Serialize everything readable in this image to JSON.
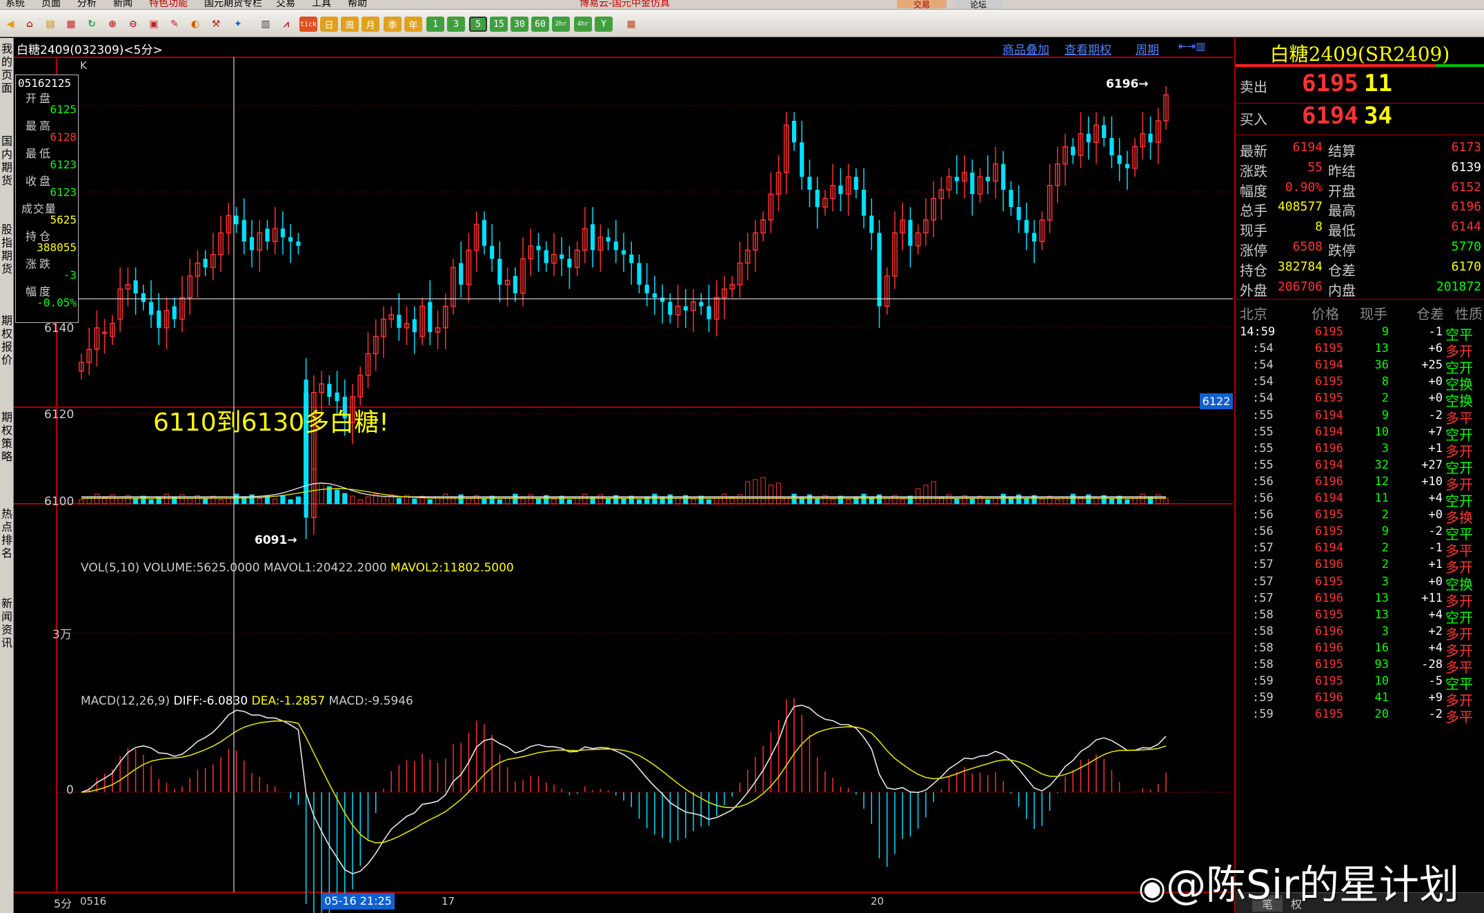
{
  "menubar": {
    "items": [
      "系统",
      "页面",
      "分析",
      "新闻",
      "特色功能",
      "国元期货专栏",
      "交易",
      "工具",
      "帮助"
    ],
    "title": "博易云-国元中金仿真",
    "trade_btn": "交易",
    "forum_btn": "论坛"
  },
  "toolbar": {
    "periods": [
      "tick",
      "日",
      "周",
      "月",
      "季",
      "年",
      "1",
      "3",
      "5",
      "15",
      "30",
      "60",
      "2hr",
      "4hr",
      "Y"
    ],
    "active_period": "5"
  },
  "sidenav": [
    "我的页面",
    "国内期货",
    "股指期货",
    "期权报价",
    "期权策略",
    "热点排名",
    "新闻资讯"
  ],
  "chart": {
    "header_title": "白糖2409(032309)<5分>",
    "links": [
      "商品叠加",
      "查看期权",
      "周期"
    ],
    "k_label": "K",
    "cursor_value": "6122",
    "annotation": "6110到6130多白糖!",
    "max_label": "6196",
    "min_label": "6091",
    "price_ticks": [
      "6140",
      "6120",
      "6100"
    ],
    "vol_tick": "3万",
    "macd_tick": "0",
    "vol_legend": {
      "prefix": "VOL(5,10) VOLUME:5625.0000 MAVOL1:20422.2000",
      "mavol2": "MAVOL2:11802.5000"
    },
    "macd_legend": {
      "name": "MACD(12,26,9)",
      "diff": "DIFF:-6.0830",
      "dea": "DEA:-1.2857",
      "macd": "MACD:-9.5946"
    },
    "xaxis": {
      "period": "5分",
      "labels": [
        "0516",
        "17",
        "20"
      ],
      "cursor_time": "05-16 21:25"
    },
    "info": {
      "time": "05162125",
      "rows": [
        {
          "label": "开盘",
          "value": "6125",
          "color": "#00ff00"
        },
        {
          "label": "最高",
          "value": "6128",
          "color": "#ff3232"
        },
        {
          "label": "最低",
          "value": "6123",
          "color": "#00ff00"
        },
        {
          "label": "收盘",
          "value": "6123",
          "color": "#00ff00"
        },
        {
          "label": "成交量",
          "value": "5625",
          "color": "#ffff00"
        },
        {
          "label": "持仓",
          "value": "388055",
          "color": "#ffff00"
        },
        {
          "label": "涨跌",
          "value": "-3",
          "color": "#00ff00"
        },
        {
          "label": "幅度",
          "value": "-0.05%",
          "color": "#00ff00"
        }
      ]
    }
  },
  "chart_data": {
    "type": "candlestick",
    "symbol": "白糖2409",
    "period": "5分",
    "ylim": [
      6085,
      6200
    ],
    "close": [
      6132,
      6135,
      6140,
      6139,
      6141,
      6149,
      6150,
      6148,
      6146,
      6143,
      6140,
      6144,
      6142,
      6147,
      6152,
      6155,
      6154,
      6157,
      6162,
      6166,
      6164,
      6160,
      6158,
      6162,
      6160,
      6163,
      6161,
      6160,
      6159,
      6096,
      6125,
      6127,
      6124,
      6123,
      6119,
      6124,
      6129,
      6134,
      6138,
      6142,
      6143,
      6140,
      6141,
      6139,
      6145,
      6139,
      6140,
      6145,
      6154,
      6150,
      6158,
      6164,
      6159,
      6156,
      6150,
      6151,
      6148,
      6156,
      6159,
      6158,
      6155,
      6157,
      6156,
      6154,
      6158,
      6163,
      6158,
      6161,
      6160,
      6158,
      6157,
      6155,
      6150,
      6148,
      6147,
      6146,
      6143,
      6145,
      6144,
      6146,
      6145,
      6142,
      6147,
      6149,
      6150,
      6155,
      6158,
      6162,
      6165,
      6171,
      6176,
      6187,
      6183,
      6175,
      6172,
      6168,
      6170,
      6173,
      6171,
      6175,
      6172,
      6166,
      6162,
      6145,
      6152,
      6162,
      6165,
      6159,
      6162,
      6165,
      6170,
      6172,
      6175,
      6174,
      6176,
      6171,
      6175,
      6174,
      6178,
      6172,
      6168,
      6165,
      6162,
      6160,
      6165,
      6173,
      6178,
      6182,
      6180,
      6185,
      6183,
      6187,
      6184,
      6180,
      6178,
      6177,
      6182,
      6185,
      6183,
      6188,
      6194
    ],
    "open": [
      6130,
      6132,
      6135,
      6139,
      6138,
      6142,
      6149,
      6151,
      6148,
      6146,
      6144,
      6140,
      6145,
      6142,
      6147,
      6152,
      6156,
      6154,
      6157,
      6162,
      6166,
      6165,
      6161,
      6158,
      6163,
      6160,
      6163,
      6161,
      6160,
      6128,
      6096,
      6125,
      6127,
      6125,
      6124,
      6118,
      6124,
      6129,
      6134,
      6138,
      6142,
      6143,
      6140,
      6142,
      6138,
      6146,
      6139,
      6140,
      6145,
      6155,
      6150,
      6158,
      6165,
      6159,
      6156,
      6150,
      6152,
      6148,
      6156,
      6159,
      6158,
      6155,
      6157,
      6156,
      6154,
      6158,
      6164,
      6158,
      6161,
      6160,
      6158,
      6157,
      6155,
      6150,
      6148,
      6147,
      6146,
      6143,
      6145,
      6144,
      6146,
      6145,
      6142,
      6147,
      6149,
      6150,
      6155,
      6158,
      6162,
      6165,
      6171,
      6176,
      6188,
      6183,
      6175,
      6172,
      6168,
      6170,
      6173,
      6171,
      6175,
      6172,
      6166,
      6162,
      6145,
      6152,
      6162,
      6165,
      6159,
      6162,
      6165,
      6170,
      6172,
      6175,
      6174,
      6176,
      6171,
      6175,
      6174,
      6178,
      6172,
      6168,
      6165,
      6162,
      6160,
      6165,
      6173,
      6178,
      6182,
      6180,
      6185,
      6183,
      6187,
      6184,
      6180,
      6178,
      6177,
      6182,
      6185,
      6183,
      6188
    ],
    "macd_range": [
      -9.8,
      8
    ]
  },
  "right_panel": {
    "title": "白糖2409(SR2409)",
    "ask": {
      "label": "卖出",
      "price": "6195",
      "qty": "11"
    },
    "bid": {
      "label": "买入",
      "price": "6194",
      "qty": "34"
    },
    "stats": [
      {
        "l": "最新",
        "v": "6194",
        "vc": "#ff3232",
        "l2": "结算",
        "v2": "6173",
        "v2c": "#ff3232"
      },
      {
        "l": "涨跌",
        "v": "55",
        "vc": "#ff3232",
        "l2": "昨结",
        "v2": "6139",
        "v2c": "#ffffff"
      },
      {
        "l": "幅度",
        "v": "0.90%",
        "vc": "#ff3232",
        "l2": "开盘",
        "v2": "6152",
        "v2c": "#ff3232"
      },
      {
        "l": "总手",
        "v": "408577",
        "vc": "#ffff00",
        "l2": "最高",
        "v2": "6196",
        "v2c": "#ff3232"
      },
      {
        "l": "现手",
        "v": "8",
        "vc": "#ffff00",
        "l2": "最低",
        "v2": "6144",
        "v2c": "#ff3232"
      },
      {
        "l": "涨停",
        "v": "6508",
        "vc": "#ff3232",
        "l2": "跌停",
        "v2": "5770",
        "v2c": "#00ff00"
      },
      {
        "l": "持仓",
        "v": "382784",
        "vc": "#ffff00",
        "l2": "仓差",
        "v2": "6170",
        "v2c": "#ffff00"
      },
      {
        "l": "外盘",
        "v": "206706",
        "vc": "#ff3232",
        "l2": "内盘",
        "v2": "201872",
        "v2c": "#00ff00"
      }
    ],
    "tick_header": [
      "北京",
      "价格",
      "现手",
      "仓差",
      "性质"
    ],
    "ticks": [
      [
        "14:59",
        "6195",
        "9",
        "-1",
        "空平",
        "#ff3232",
        "#00ff00"
      ],
      [
        ":54",
        "6195",
        "13",
        "+6",
        "多开",
        "#ff3232",
        "#ff3232"
      ],
      [
        ":54",
        "6194",
        "36",
        "+25",
        "空开",
        "#ff3232",
        "#00ff00"
      ],
      [
        ":54",
        "6195",
        "8",
        "+0",
        "空换",
        "#ff3232",
        "#00ff00"
      ],
      [
        ":54",
        "6195",
        "2",
        "+0",
        "空换",
        "#ff3232",
        "#00ff00"
      ],
      [
        ":55",
        "6194",
        "9",
        "-2",
        "多平",
        "#ff3232",
        "#ff3232"
      ],
      [
        ":55",
        "6194",
        "10",
        "+7",
        "空开",
        "#ff3232",
        "#00ff00"
      ],
      [
        ":55",
        "6196",
        "3",
        "+1",
        "多开",
        "#ff3232",
        "#ff3232"
      ],
      [
        ":55",
        "6194",
        "32",
        "+27",
        "空开",
        "#ff3232",
        "#00ff00"
      ],
      [
        ":56",
        "6196",
        "12",
        "+10",
        "多开",
        "#ff3232",
        "#ff3232"
      ],
      [
        ":56",
        "6194",
        "11",
        "+4",
        "空开",
        "#ff3232",
        "#00ff00"
      ],
      [
        ":56",
        "6195",
        "2",
        "+0",
        "多换",
        "#ff3232",
        "#ff3232"
      ],
      [
        ":56",
        "6195",
        "9",
        "-2",
        "空平",
        "#ff3232",
        "#00ff00"
      ],
      [
        ":57",
        "6194",
        "2",
        "-1",
        "多平",
        "#ff3232",
        "#ff3232"
      ],
      [
        ":57",
        "6196",
        "2",
        "+1",
        "多开",
        "#ff3232",
        "#ff3232"
      ],
      [
        ":57",
        "6195",
        "3",
        "+0",
        "空换",
        "#ff3232",
        "#00ff00"
      ],
      [
        ":57",
        "6196",
        "13",
        "+11",
        "多开",
        "#ff3232",
        "#ff3232"
      ],
      [
        ":58",
        "6195",
        "13",
        "+4",
        "空开",
        "#ff3232",
        "#00ff00"
      ],
      [
        ":58",
        "6196",
        "3",
        "+2",
        "多开",
        "#ff3232",
        "#ff3232"
      ],
      [
        ":58",
        "6196",
        "16",
        "+4",
        "多开",
        "#ff3232",
        "#ff3232"
      ],
      [
        ":58",
        "6195",
        "93",
        "-28",
        "多平",
        "#ff3232",
        "#ff3232"
      ],
      [
        ":59",
        "6195",
        "10",
        "-5",
        "空平",
        "#ff3232",
        "#00ff00"
      ],
      [
        ":59",
        "6196",
        "41",
        "+9",
        "多开",
        "#ff3232",
        "#ff3232"
      ],
      [
        ":59",
        "6195",
        "20",
        "-2",
        "多平",
        "#ff3232",
        "#ff3232"
      ]
    ],
    "bottom_tabs": [
      "笔",
      "权"
    ]
  },
  "watermark": "@陈Sir的星计划"
}
